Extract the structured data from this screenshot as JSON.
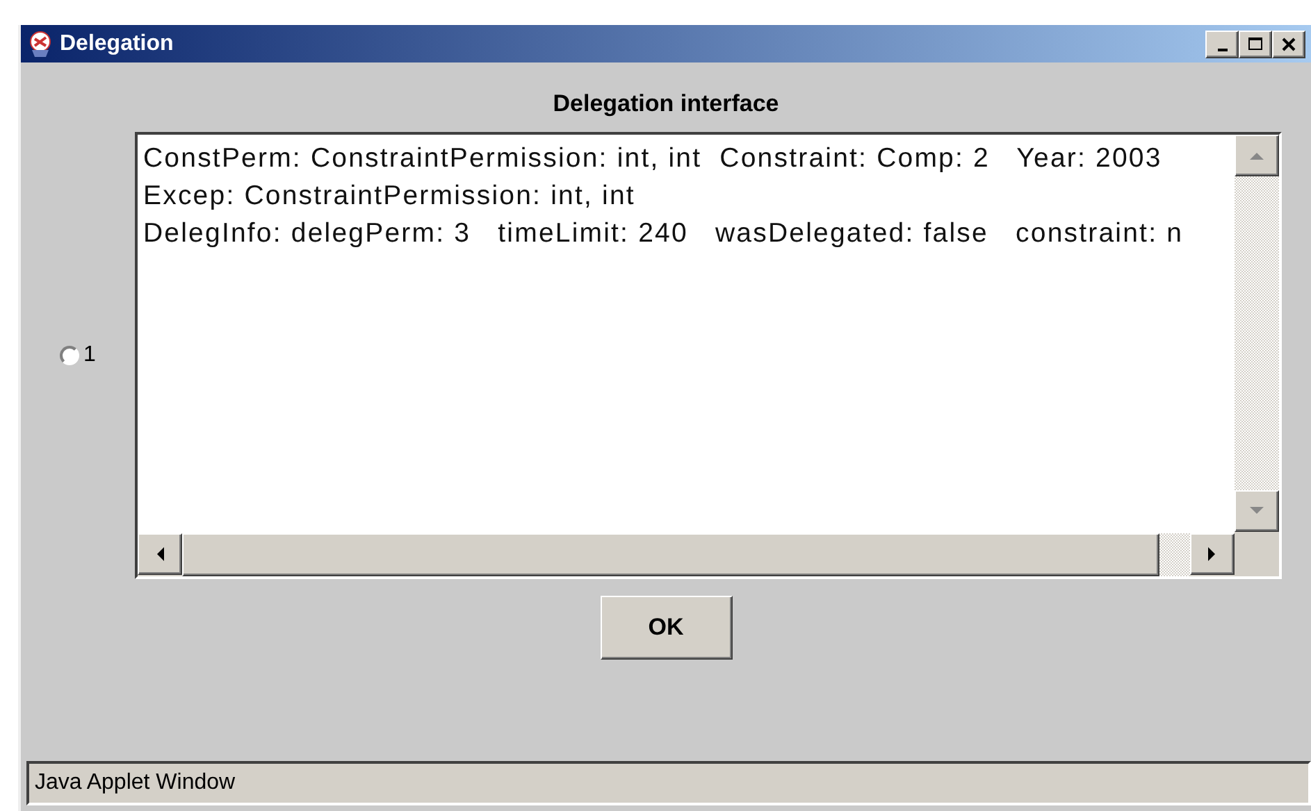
{
  "window": {
    "title": "Delegation"
  },
  "heading": "Delegation interface",
  "options": [
    {
      "label": "1",
      "selected": false
    }
  ],
  "text_area": {
    "lines": [
      "ConstPerm: ConstraintPermission: int, int  Constraint: Comp: 2   Year: 2003",
      "Excep: ConstraintPermission: int, int",
      "DelegInfo: delegPerm: 3   timeLimit: 240   wasDelegated: false   constraint: n"
    ]
  },
  "buttons": [
    {
      "label": "OK"
    }
  ],
  "status_bar": "Java Applet Window"
}
